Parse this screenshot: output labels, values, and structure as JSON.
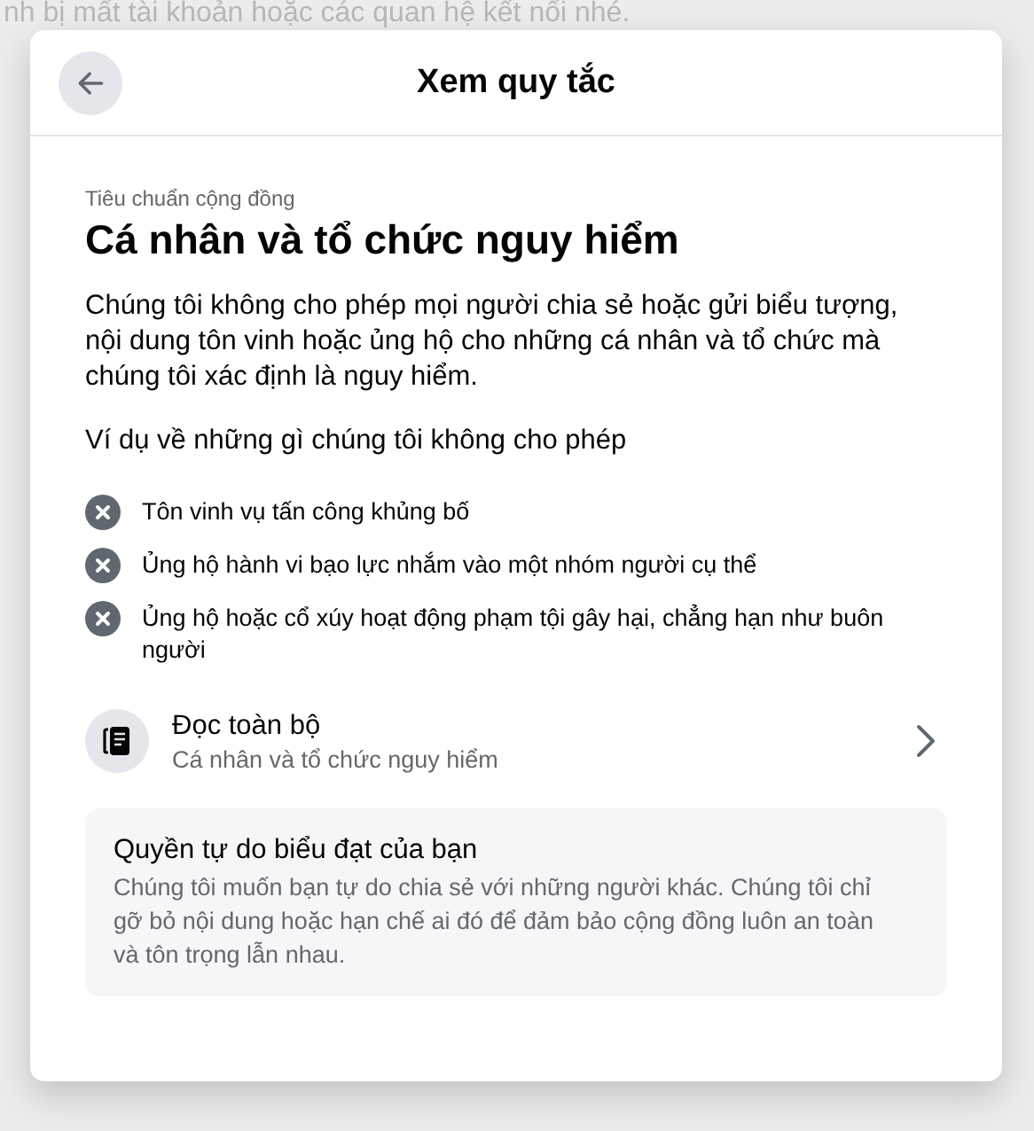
{
  "backdrop_text": "nh bị mất tài khoản hoặc các quan hệ kết nối nhé.",
  "dialog": {
    "title": "Xem quy tắc",
    "category": "Tiêu chuẩn cộng đồng",
    "heading": "Cá nhân và tổ chức nguy hiểm",
    "description": "Chúng tôi không cho phép mọi người chia sẻ hoặc gửi biểu tượng, nội dung tôn vinh hoặc ủng hộ cho những cá nhân và tổ chức mà chúng tôi xác định là nguy hiểm.",
    "examples_heading": "Ví dụ về những gì chúng tôi không cho phép",
    "examples": [
      {
        "text": "Tôn vinh vụ tấn công khủng bố"
      },
      {
        "text": "Ủng hộ hành vi bạo lực nhắm vào một nhóm người cụ thể"
      },
      {
        "text": "Ủng hộ hoặc cổ xúy hoạt động phạm tội gây hại, chẳng hạn như buôn người"
      }
    ],
    "read_all": {
      "title": "Đọc toàn bộ",
      "subtitle": "Cá nhân và tổ chức nguy hiểm"
    },
    "info_card": {
      "title": "Quyền tự do biểu đạt của bạn",
      "body": "Chúng tôi muốn bạn tự do chia sẻ với những người khác. Chúng tôi chỉ gỡ bỏ nội dung hoặc hạn chế ai đó để đảm bảo cộng đồng luôn an toàn và tôn trọng lẫn nhau."
    }
  }
}
